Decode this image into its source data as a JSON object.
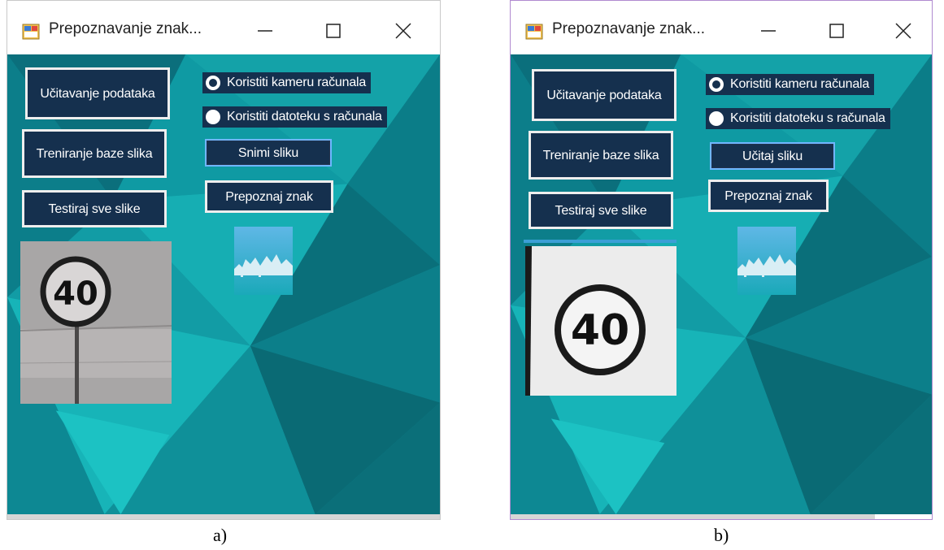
{
  "window_title": "Prepoznavanje znak...",
  "panels": [
    {
      "caption": "a)",
      "buttons": {
        "load_data": "Učitavanje podataka",
        "train": "Treniranje baze slika",
        "test_all": "Testiraj sve slike",
        "capture": "Snimi sliku",
        "recognize": "Prepoznaj znak"
      },
      "radios": [
        {
          "label": "Koristiti kameru računala",
          "checked": true
        },
        {
          "label": "Koristiti datoteku s računala",
          "checked": false
        }
      ],
      "sign_text": "40"
    },
    {
      "caption": "b)",
      "buttons": {
        "load_data": "Učitavanje podataka",
        "train": "Treniranje baze slika",
        "test_all": "Testiraj sve slike",
        "load_image": "Učitaj sliku",
        "recognize": "Prepoznaj znak"
      },
      "radios": [
        {
          "label": "Koristiti kameru računala",
          "checked": true
        },
        {
          "label": "Koristiti datoteku s računala",
          "checked": false
        }
      ],
      "sign_text": "40"
    }
  ],
  "colors": {
    "button_bg": "#15304e",
    "background_teal": "#0f8c98",
    "focus_border": "#6fb6ff"
  },
  "icons": [
    "app-icon",
    "minimize-icon",
    "maximize-icon",
    "close-icon"
  ]
}
